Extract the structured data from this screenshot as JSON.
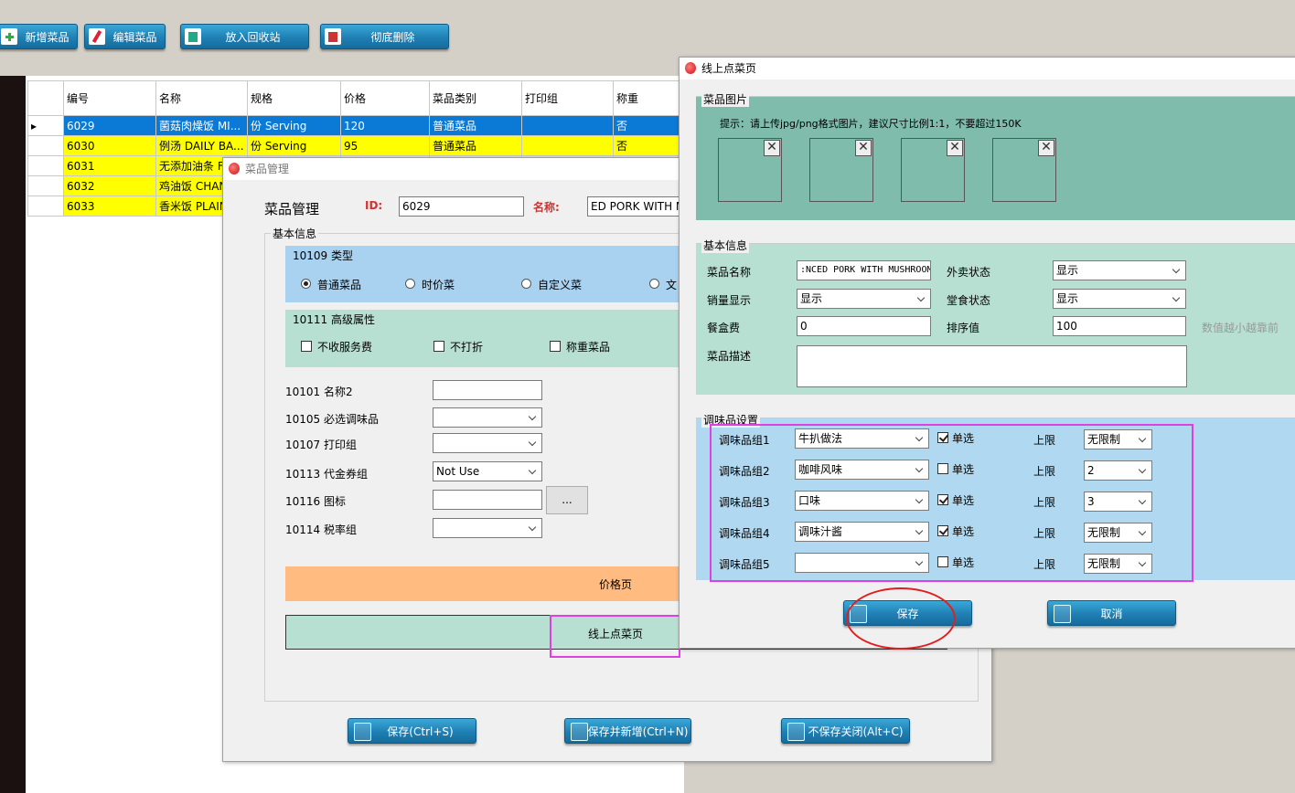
{
  "toolbar": {
    "add_label": "新增菜品",
    "edit_label": "编辑菜品",
    "recycle_label": "放入回收站",
    "delete_label": "彻底删除"
  },
  "grid": {
    "headers": [
      "编号",
      "名称",
      "规格",
      "价格",
      "菜品类别",
      "打印组",
      "称重"
    ],
    "rows": [
      [
        "6029",
        "菌菇肉燥饭 MI...",
        "份 Serving",
        "120",
        "普通菜品",
        "",
        "否"
      ],
      [
        "6030",
        "例汤 DAILY BA...",
        "份 Serving",
        "95",
        "普通菜品",
        "",
        "否"
      ],
      [
        "6031",
        "无添加油条 F",
        "",
        "",
        "",
        "",
        ""
      ],
      [
        "6032",
        "鸡油饭 CHAN",
        "",
        "",
        "",
        "",
        ""
      ],
      [
        "6033",
        "香米饭 PLAIN",
        "",
        "",
        "",
        "",
        ""
      ]
    ]
  },
  "dish_dialog": {
    "title": "菜品管理",
    "heading": "菜品管理",
    "id_label": "ID:",
    "id_value": "6029",
    "name_label": "名称:",
    "name_value": "ED PORK WITH M",
    "basic_group": "基本信息",
    "type_group": "10109 类型",
    "type_options": [
      "普通菜品",
      "时价菜",
      "自定义菜",
      "文"
    ],
    "adv_group": "10111 高级属性",
    "adv_options": [
      "不收服务费",
      "不打折",
      "称重菜品"
    ],
    "rows": [
      {
        "label": "10101 名称2",
        "value": ""
      },
      {
        "label": "10105 必选调味品",
        "value": ""
      },
      {
        "label": "10107 打印组",
        "value": ""
      },
      {
        "label": "10113 代金券组",
        "value": "Not Use"
      },
      {
        "label": "10116 图标",
        "value": ""
      },
      {
        "label": "10114 税率组",
        "value": ""
      }
    ],
    "browse_label": "...",
    "price_page": "价格页",
    "online_page": "线上点菜页",
    "save": "保存(Ctrl+S)",
    "save_new": "保存并新增(Ctrl+N)",
    "close_nosave": "不保存关闭(Alt+C)"
  },
  "online_dialog": {
    "title": "线上点菜页",
    "photo_group": "菜品图片",
    "photo_hint": "提示：请上传jpg/png格式图片，建议尺寸比例1:1，不要超过150K",
    "thumb_close": "✕",
    "basic_group": "基本信息",
    "dish_name_label": "菜品名称",
    "dish_name_value": ":NCED PORK WITH MUSHROOM",
    "takeout_label": "外卖状态",
    "takeout_value": "显示",
    "sales_label": "销量显示",
    "sales_value": "显示",
    "dinein_label": "堂食状态",
    "dinein_value": "显示",
    "box_fee_label": "餐盒费",
    "box_fee_value": "0",
    "sort_label": "排序值",
    "sort_value": "100",
    "sort_hint": "数值越小越靠前",
    "desc_label": "菜品描述",
    "seasoning_group": "调味品设置",
    "single_label": "单选",
    "limit_label": "上限",
    "seasonings": [
      {
        "label": "调味品组1",
        "value": "牛扒做法",
        "single": true,
        "limit": "无限制"
      },
      {
        "label": "调味品组2",
        "value": "咖啡风味",
        "single": false,
        "limit": "2"
      },
      {
        "label": "调味品组3",
        "value": "口味",
        "single": true,
        "limit": "3"
      },
      {
        "label": "调味品组4",
        "value": "调味汁酱",
        "single": true,
        "limit": "无限制"
      },
      {
        "label": "调味品组5",
        "value": "",
        "single": false,
        "limit": "无限制"
      }
    ],
    "save": "保存",
    "cancel": "取消"
  },
  "colors": {
    "button": "#1f7fb3",
    "selected_row": "#0a7ad6",
    "yellow_row": "#ffff00",
    "photo_panel": "#7fbcac",
    "basic_panel": "#b8e0d2",
    "seasoning_panel": "#b0d8f0",
    "highlight": "#e040e0",
    "circle": "#e02020",
    "price_tab": "#ffbb80"
  }
}
